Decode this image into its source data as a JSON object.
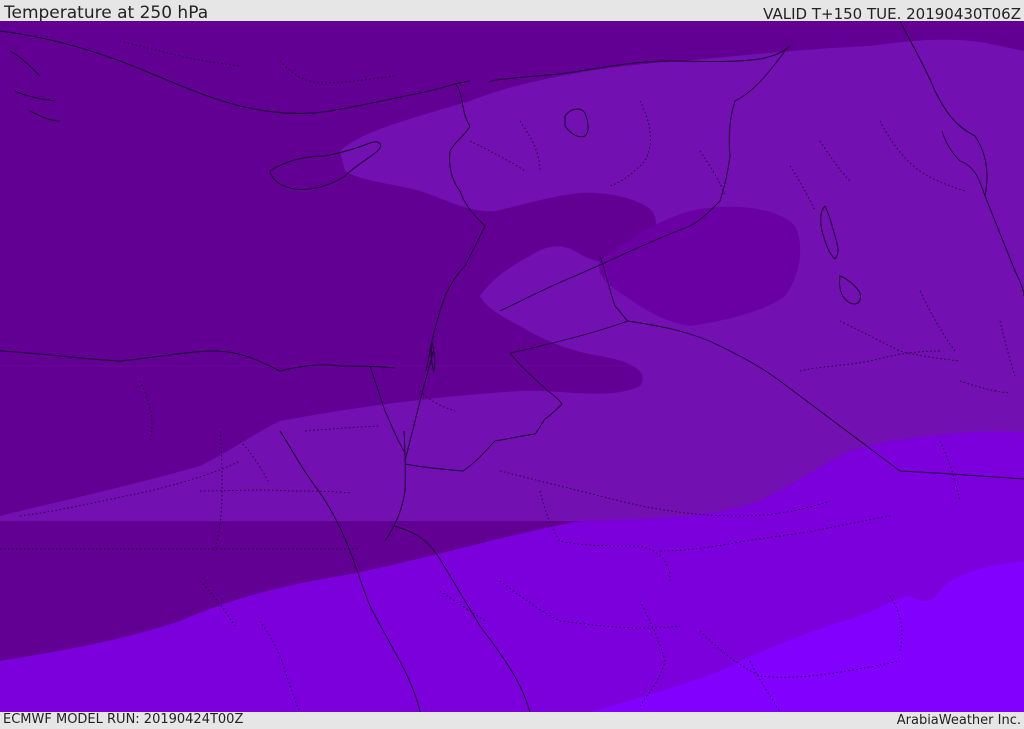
{
  "header": {
    "title": "Temperature at 250 hPa",
    "valid_time": "VALID T+150 TUE. 20190430T06Z"
  },
  "footer": {
    "model_run": "ECMWF MODEL RUN: 20190424T00Z",
    "credit": "ArabiaWeather Inc."
  },
  "map": {
    "field": "temperature",
    "level_hpa": 250,
    "shading_colors": {
      "darkest": "#620093",
      "dark": "#6a00a3",
      "mid": "#7310b1",
      "bright": "#7c00dc",
      "brightest": "#8200fe"
    },
    "border_color": "#1a0030"
  }
}
